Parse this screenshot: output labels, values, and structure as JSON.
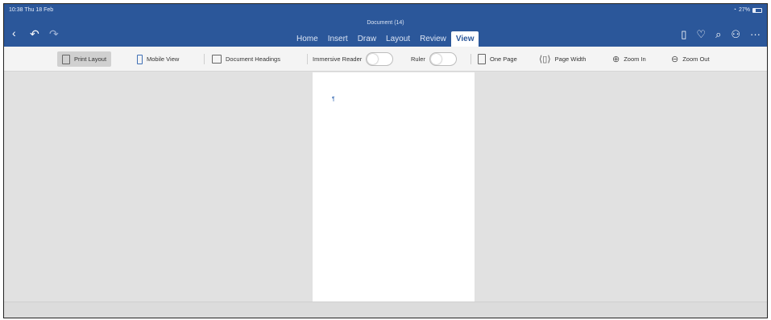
{
  "status": {
    "time": "10:38  Thu 18 Feb",
    "battery": "27%"
  },
  "document": {
    "title": "Document (14)",
    "paragraph_mark": "¶"
  },
  "nav": {
    "back_icon": "‹",
    "undo_icon": "↶",
    "redo_icon": "↷"
  },
  "tabs": [
    "Home",
    "Insert",
    "Draw",
    "Layout",
    "Review",
    "View"
  ],
  "active_tab": "View",
  "ribbon": {
    "print_layout": "Print Layout",
    "mobile_view": "Mobile View",
    "document_headings": "Document Headings",
    "immersive_reader": "Immersive Reader",
    "ruler": "Ruler",
    "one_page": "One Page",
    "page_width": "Page Width",
    "zoom_in": "Zoom In",
    "zoom_out": "Zoom Out"
  },
  "right_icons": {
    "device": "▯",
    "lightbulb": "♡",
    "search": "⌕",
    "share": "⚇",
    "more": "···"
  },
  "colors": {
    "accent": "#2b579a",
    "canvas": "#e1e1e1",
    "ribbon": "#f4f4f4"
  }
}
